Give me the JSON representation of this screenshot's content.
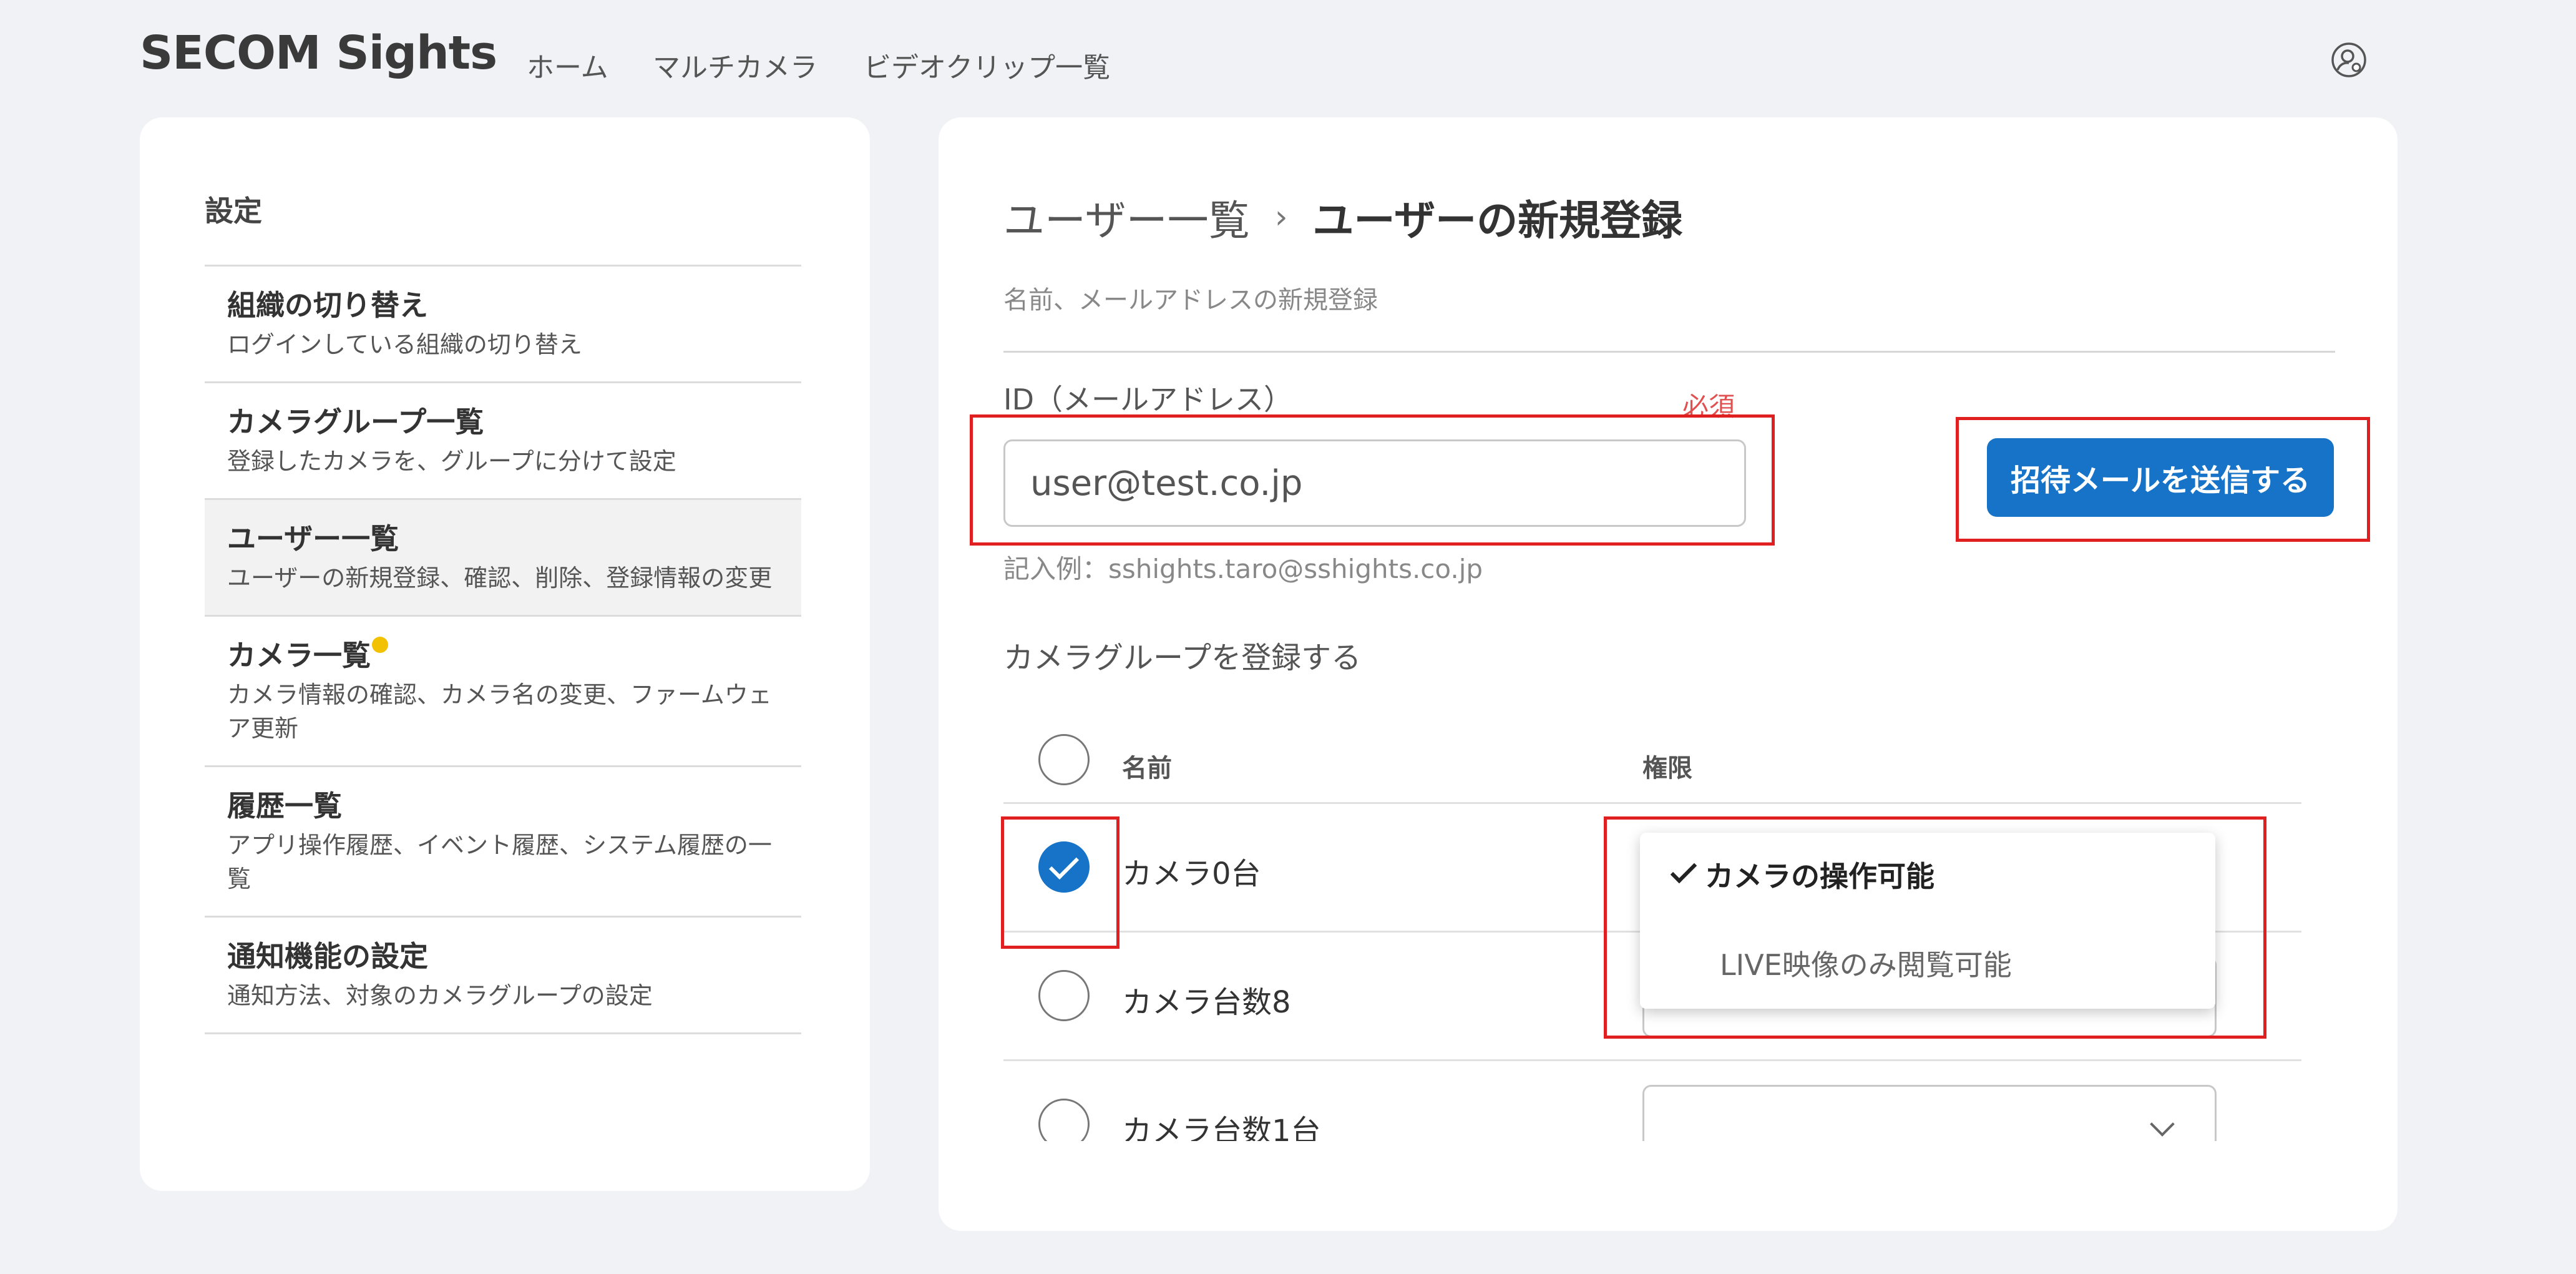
{
  "header": {
    "logo": "SECOM Sights",
    "nav": [
      "ホーム",
      "マルチカメラ",
      "ビデオクリップ一覧"
    ],
    "user_icon": "user-settings-icon"
  },
  "sidebar": {
    "title": "設定",
    "items": [
      {
        "label": "組織の切り替え",
        "desc": "ログインしている組織の切り替え",
        "active": false,
        "badge": false
      },
      {
        "label": "カメラグループ一覧",
        "desc": "登録したカメラを、グループに分けて設定",
        "active": false,
        "badge": false
      },
      {
        "label": "ユーザー一覧",
        "desc": "ユーザーの新規登録、確認、削除、登録情報の変更",
        "active": true,
        "badge": false
      },
      {
        "label": "カメラ一覧",
        "desc": "カメラ情報の確認、カメラ名の変更、ファームウェア更新",
        "active": false,
        "badge": true
      },
      {
        "label": "履歴一覧",
        "desc": "アプリ操作履歴、イベント履歴、システム履歴の一覧",
        "active": false,
        "badge": false
      },
      {
        "label": "通知機能の設定",
        "desc": "通知方法、対象のカメラグループの設定",
        "active": false,
        "badge": false
      }
    ]
  },
  "main": {
    "breadcrumb": {
      "parent": "ユーザー一覧",
      "separator": "›",
      "current": "ユーザーの新規登録"
    },
    "subtitle": "名前、メールアドレスの新規登録",
    "email": {
      "label": "ID（メールアドレス）",
      "required": "必須",
      "value": "user@test.co.jp",
      "example": "記入例：sshights.taro@sshights.co.jp"
    },
    "send_button": "招待メールを送信する",
    "camera_section": "カメラグループを登録する",
    "table": {
      "columns": [
        "名前",
        "権限"
      ],
      "rows": [
        {
          "name": "カメラ0台",
          "checked": true
        },
        {
          "name": "カメラ台数8",
          "checked": false
        },
        {
          "name": "カメラ台数1台",
          "checked": false
        }
      ]
    },
    "permission_dropdown": {
      "selected": "カメラの操作可能",
      "options": [
        "カメラの操作可能",
        "LIVE映像のみ閲覧可能"
      ]
    }
  },
  "colors": {
    "accent": "#1673c7",
    "highlight": "#e02020",
    "badge": "#f2c200",
    "required": "#e05050"
  }
}
